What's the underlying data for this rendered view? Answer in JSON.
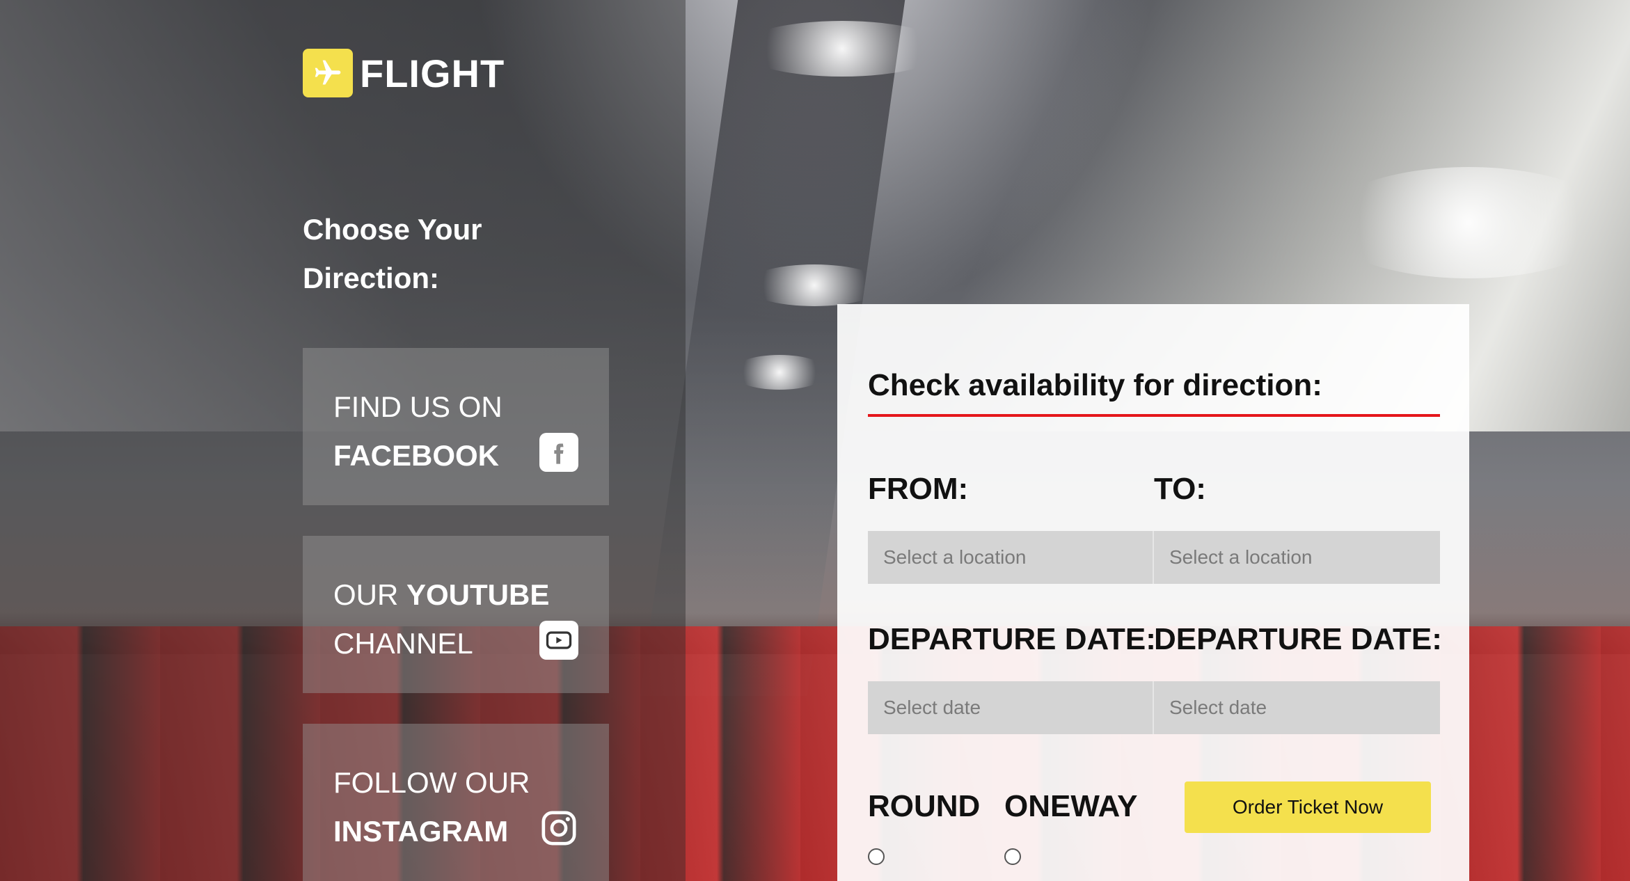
{
  "brand": {
    "logo_text": "FLIGHT",
    "accent_color": "#f4e04d"
  },
  "sidebar": {
    "heading": "Choose Your Direction:",
    "social": [
      {
        "line1_regular": "FIND US ON",
        "line1_bold": "",
        "line2_regular": "",
        "line2_bold": "FACEBOOK",
        "icon": "facebook-icon"
      },
      {
        "line1_regular": "OUR ",
        "line1_bold": "YOUTUBE",
        "line2_regular": "CHANNEL",
        "line2_bold": "",
        "icon": "youtube-icon"
      },
      {
        "line1_regular": "FOLLOW OUR",
        "line1_bold": "",
        "line2_regular": "",
        "line2_bold": "INSTAGRAM",
        "icon": "instagram-icon"
      }
    ]
  },
  "booking": {
    "title": "Check availability for direction:",
    "underline_color": "#e5161b",
    "from_label": "FROM:",
    "to_label": "TO:",
    "from_placeholder": "Select a location",
    "to_placeholder": "Select a location",
    "departure_label_left": "DEPARTURE DATE:",
    "departure_label_right": "DEPARTURE DATE:",
    "date_placeholder_left": "Select date",
    "date_placeholder_right": "Select date",
    "round_label": "ROUND",
    "oneway_label": "ONEWAY",
    "order_button": "Order Ticket Now"
  }
}
